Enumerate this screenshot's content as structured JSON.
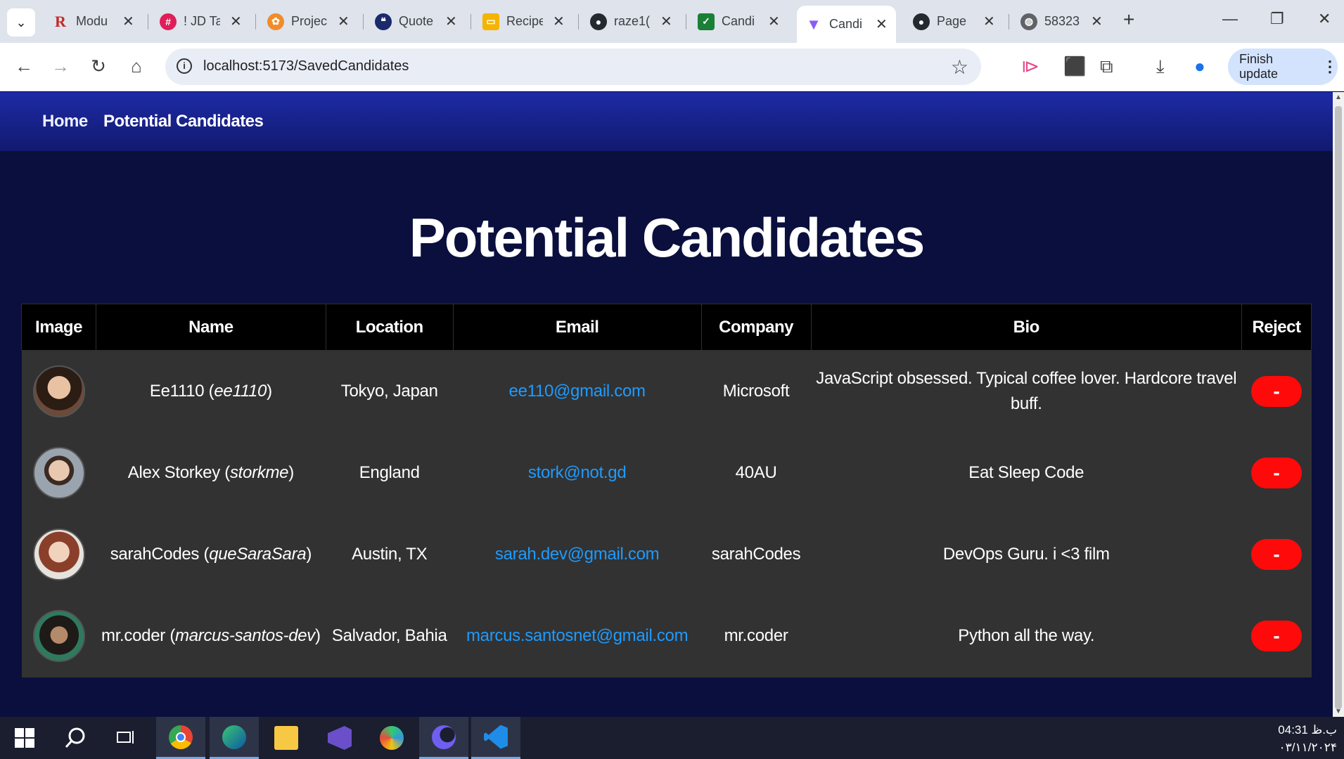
{
  "browser": {
    "tabs": [
      {
        "label": "Modu",
        "icon": "r-logo-icon",
        "color": "#c62828"
      },
      {
        "label": "! JD Ta",
        "icon": "slack-icon",
        "color": "#4a154b"
      },
      {
        "label": "Projec",
        "icon": "project-icon",
        "color": "#f28c28"
      },
      {
        "label": "Quote",
        "icon": "quote-icon",
        "color": "#1b2a6b"
      },
      {
        "label": "Recipe",
        "icon": "slides-icon",
        "color": "#f4b400"
      },
      {
        "label": "raze1(",
        "icon": "github-icon",
        "color": "#24292f"
      },
      {
        "label": "Candi",
        "icon": "candidate-icon",
        "color": "#1a7f37"
      },
      {
        "label": "Candi",
        "icon": "vite-icon",
        "color": "#8a5cf6"
      },
      {
        "label": "Page",
        "icon": "github-icon",
        "color": "#24292f"
      },
      {
        "label": "58323",
        "icon": "globe-icon",
        "color": "#5f6368"
      }
    ],
    "url": "localhost:5173/SavedCandidates",
    "finish_update": "Finish update"
  },
  "nav": {
    "home": "Home",
    "potential": "Potential Candidates"
  },
  "main": {
    "title": "Potential Candidates",
    "columns": [
      "Image",
      "Name",
      "Location",
      "Email",
      "Company",
      "Bio",
      "Reject"
    ],
    "reject_label": "-",
    "rows": [
      {
        "name": "Ee1110",
        "login": "ee1110",
        "location": "Tokyo, Japan",
        "email": "ee110@gmail.com",
        "company": "Microsoft",
        "bio": "JavaScript obsessed. Typical coffee lover. Hardcore travel buff.",
        "avatar_color": "#6b4a3a"
      },
      {
        "name": "Alex Storkey",
        "login": "storkme",
        "location": "England",
        "email": "stork@not.gd",
        "company": "40AU",
        "bio": "Eat Sleep Code",
        "avatar_color": "#7b8794"
      },
      {
        "name": "sarahCodes",
        "login": "queSaraSara",
        "location": "Austin, TX",
        "email": "sarah.dev@gmail.com",
        "company": "sarahCodes",
        "bio": "DevOps Guru. i <3 film",
        "avatar_color": "#a0523c"
      },
      {
        "name": "mr.coder",
        "login": "marcus-santos-dev",
        "location": "Salvador, Bahia",
        "email": "marcus.santosnet@gmail.com",
        "company": "mr.coder",
        "bio": "Python all the way.",
        "avatar_color": "#3d3a36"
      }
    ]
  },
  "taskbar": {
    "time": "04:31 ب.ظ",
    "date": "۰۳/۱۱/۲۰۲۴"
  }
}
